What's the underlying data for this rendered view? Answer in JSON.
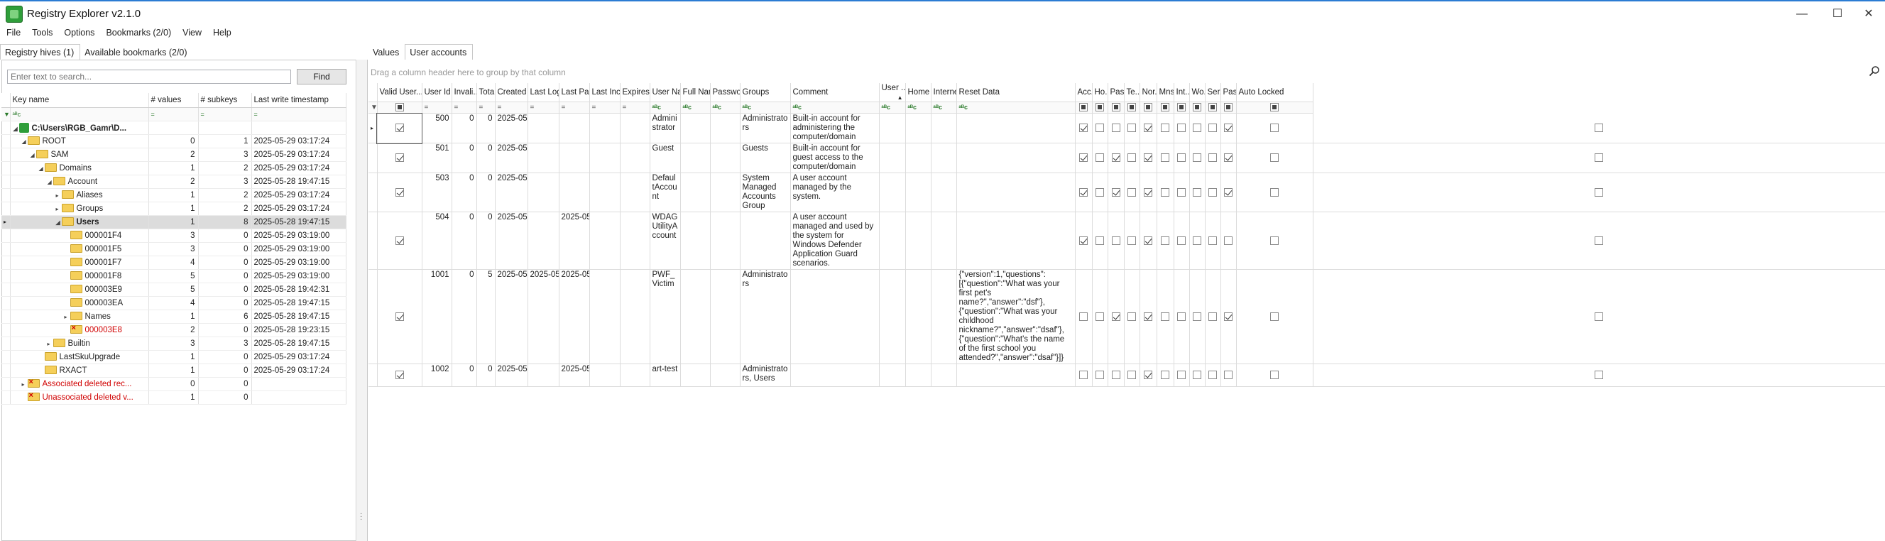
{
  "window": {
    "title": "Registry Explorer v2.1.0",
    "minimize": "—",
    "maximize": "☐",
    "close": "✕"
  },
  "menu": [
    "File",
    "Tools",
    "Options",
    "Bookmarks (2/0)",
    "View",
    "Help"
  ],
  "left_tabs": [
    "Registry hives (1)",
    "Available bookmarks (2/0)"
  ],
  "right_tabs": [
    "Values",
    "User accounts"
  ],
  "search": {
    "placeholder": "Enter text to search...",
    "find_label": "Find"
  },
  "tree": {
    "columns": [
      "Key name",
      "# values",
      "# subkeys",
      "Last write timestamp"
    ],
    "filter_symbols": [
      "▼",
      "ᵃᴮc",
      "=",
      "=",
      "="
    ],
    "rows": [
      {
        "name": "C:\\Users\\RGB_Gamr\\D...",
        "values": "",
        "subkeys": "",
        "ts": "",
        "indent": 0,
        "arrow": "◢",
        "type": "hive",
        "bold": true
      },
      {
        "name": "ROOT",
        "values": "0",
        "subkeys": "1",
        "ts": "2025-05-29 03:17:24",
        "indent": 1,
        "arrow": "◢",
        "type": "folder"
      },
      {
        "name": "SAM",
        "values": "2",
        "subkeys": "3",
        "ts": "2025-05-29 03:17:24",
        "indent": 2,
        "arrow": "◢",
        "type": "folder"
      },
      {
        "name": "Domains",
        "values": "1",
        "subkeys": "2",
        "ts": "2025-05-29 03:17:24",
        "indent": 3,
        "arrow": "◢",
        "type": "folder"
      },
      {
        "name": "Account",
        "values": "2",
        "subkeys": "3",
        "ts": "2025-05-28 19:47:15",
        "indent": 4,
        "arrow": "◢",
        "type": "folder"
      },
      {
        "name": "Aliases",
        "values": "1",
        "subkeys": "2",
        "ts": "2025-05-29 03:17:24",
        "indent": 5,
        "arrow": "▸",
        "type": "folder"
      },
      {
        "name": "Groups",
        "values": "1",
        "subkeys": "2",
        "ts": "2025-05-29 03:17:24",
        "indent": 5,
        "arrow": "▸",
        "type": "folder"
      },
      {
        "name": "Users",
        "values": "1",
        "subkeys": "8",
        "ts": "2025-05-28 19:47:15",
        "indent": 5,
        "arrow": "◢",
        "type": "folder",
        "bold": true,
        "selected": true
      },
      {
        "name": "000001F4",
        "values": "3",
        "subkeys": "0",
        "ts": "2025-05-29 03:19:00",
        "indent": 6,
        "arrow": "",
        "type": "folder"
      },
      {
        "name": "000001F5",
        "values": "3",
        "subkeys": "0",
        "ts": "2025-05-29 03:19:00",
        "indent": 6,
        "arrow": "",
        "type": "folder"
      },
      {
        "name": "000001F7",
        "values": "4",
        "subkeys": "0",
        "ts": "2025-05-29 03:19:00",
        "indent": 6,
        "arrow": "",
        "type": "folder"
      },
      {
        "name": "000001F8",
        "values": "5",
        "subkeys": "0",
        "ts": "2025-05-29 03:19:00",
        "indent": 6,
        "arrow": "",
        "type": "folder"
      },
      {
        "name": "000003E9",
        "values": "5",
        "subkeys": "0",
        "ts": "2025-05-28 19:42:31",
        "indent": 6,
        "arrow": "",
        "type": "folder"
      },
      {
        "name": "000003EA",
        "values": "4",
        "subkeys": "0",
        "ts": "2025-05-28 19:47:15",
        "indent": 6,
        "arrow": "",
        "type": "folder"
      },
      {
        "name": "Names",
        "values": "1",
        "subkeys": "6",
        "ts": "2025-05-28 19:47:15",
        "indent": 6,
        "arrow": "▸",
        "type": "folder"
      },
      {
        "name": "000003E8",
        "values": "2",
        "subkeys": "0",
        "ts": "2025-05-28 19:23:15",
        "indent": 6,
        "arrow": "",
        "type": "deleted",
        "red": true
      },
      {
        "name": "Builtin",
        "values": "3",
        "subkeys": "3",
        "ts": "2025-05-28 19:47:15",
        "indent": 4,
        "arrow": "▸",
        "type": "folder"
      },
      {
        "name": "LastSkuUpgrade",
        "values": "1",
        "subkeys": "0",
        "ts": "2025-05-29 03:17:24",
        "indent": 3,
        "arrow": "",
        "type": "folder"
      },
      {
        "name": "RXACT",
        "values": "1",
        "subkeys": "0",
        "ts": "2025-05-29 03:17:24",
        "indent": 3,
        "arrow": "",
        "type": "folder"
      },
      {
        "name": "Associated deleted rec...",
        "values": "0",
        "subkeys": "0",
        "ts": "",
        "indent": 1,
        "arrow": "▸",
        "type": "deleted",
        "red": true
      },
      {
        "name": "Unassociated deleted v...",
        "values": "1",
        "subkeys": "0",
        "ts": "",
        "indent": 1,
        "arrow": "",
        "type": "deleted-value",
        "red": true
      }
    ]
  },
  "group_bar": "Drag a column header here to group by that column",
  "accounts": {
    "columns": [
      "Valid User...",
      "User Id",
      "Invali...",
      "Tota...",
      "Created On",
      "Last Login...",
      "Last Pass...",
      "Last Incor...",
      "Expires On",
      "User Name",
      "Full Name",
      "Password ...",
      "Groups",
      "Comment",
      "User ...",
      "Home ...",
      "Interne...",
      "Reset Data",
      "Acc...",
      "Ho...",
      "Pas...",
      "Te...",
      "Nor...",
      "Mns...",
      "Int...",
      "Wo...",
      "Ser...",
      "Pas...",
      "Auto Locked"
    ],
    "sort_indicator": "▲",
    "rows": [
      {
        "valid": true,
        "id": "500",
        "invalid": "0",
        "total": "0",
        "created": "2025-05-...",
        "lastlogin": "",
        "lastpass": "",
        "lastincorrect": "",
        "expires": "",
        "username": "Administrator",
        "fullname": "",
        "passwordhint": "",
        "groups": "Administrators",
        "comment": "Built-in account for administering the computer/domain",
        "userprofile": "",
        "home": "",
        "internet": "",
        "reset": "",
        "flags": [
          true,
          false,
          false,
          false,
          true,
          false,
          false,
          false,
          false,
          true,
          false
        ]
      },
      {
        "valid": true,
        "id": "501",
        "invalid": "0",
        "total": "0",
        "created": "2025-05-...",
        "lastlogin": "",
        "lastpass": "",
        "lastincorrect": "",
        "expires": "",
        "username": "Guest",
        "fullname": "",
        "passwordhint": "",
        "groups": "Guests",
        "comment": "Built-in account for guest access to the computer/domain",
        "userprofile": "",
        "home": "",
        "internet": "",
        "reset": "",
        "flags": [
          true,
          false,
          true,
          false,
          true,
          false,
          false,
          false,
          false,
          true,
          false
        ]
      },
      {
        "valid": true,
        "id": "503",
        "invalid": "0",
        "total": "0",
        "created": "2025-05-...",
        "lastlogin": "",
        "lastpass": "",
        "lastincorrect": "",
        "expires": "",
        "username": "DefaultAccount",
        "fullname": "",
        "passwordhint": "",
        "groups": "System Managed Accounts Group",
        "comment": "A user account managed by the system.",
        "userprofile": "",
        "home": "",
        "internet": "",
        "reset": "",
        "flags": [
          true,
          false,
          true,
          false,
          true,
          false,
          false,
          false,
          false,
          true,
          false
        ]
      },
      {
        "valid": true,
        "id": "504",
        "invalid": "0",
        "total": "0",
        "created": "2025-05-...",
        "lastlogin": "",
        "lastpass": "2025-05-...",
        "lastincorrect": "",
        "expires": "",
        "username": "WDAGUtilityAccount",
        "fullname": "",
        "passwordhint": "",
        "groups": "",
        "comment": "A user account managed and used by the system for Windows Defender Application Guard scenarios.",
        "userprofile": "",
        "home": "",
        "internet": "",
        "reset": "",
        "flags": [
          true,
          false,
          false,
          false,
          true,
          false,
          false,
          false,
          false,
          false,
          false
        ]
      },
      {
        "valid": true,
        "id": "1001",
        "invalid": "0",
        "total": "5",
        "created": "2025-05-...",
        "lastlogin": "2025-05-...",
        "lastpass": "2025-05-...",
        "lastincorrect": "",
        "expires": "",
        "username": "PWF_Victim",
        "fullname": "",
        "passwordhint": "",
        "groups": "Administrators",
        "comment": "",
        "userprofile": "",
        "home": "",
        "internet": "",
        "reset": "{\"version\":1,\"questions\":[{\"question\":\"What was your first pet's name?\",\"answer\":\"dsf\"},{\"question\":\"What was your childhood nickname?\",\"answer\":\"dsaf\"},{\"question\":\"What's the name of the first school you attended?\",\"answer\":\"dsaf\"}]}",
        "flags": [
          false,
          false,
          true,
          false,
          true,
          false,
          false,
          false,
          false,
          true,
          false
        ]
      },
      {
        "valid": true,
        "id": "1002",
        "invalid": "0",
        "total": "0",
        "created": "2025-05-...",
        "lastlogin": "",
        "lastpass": "2025-05-...",
        "lastincorrect": "",
        "expires": "",
        "username": "art-test",
        "fullname": "",
        "passwordhint": "",
        "groups": "Administrators, Users",
        "comment": "",
        "userprofile": "",
        "home": "",
        "internet": "",
        "reset": "",
        "flags": [
          false,
          false,
          false,
          false,
          true,
          false,
          false,
          false,
          false,
          false,
          false
        ]
      }
    ]
  }
}
